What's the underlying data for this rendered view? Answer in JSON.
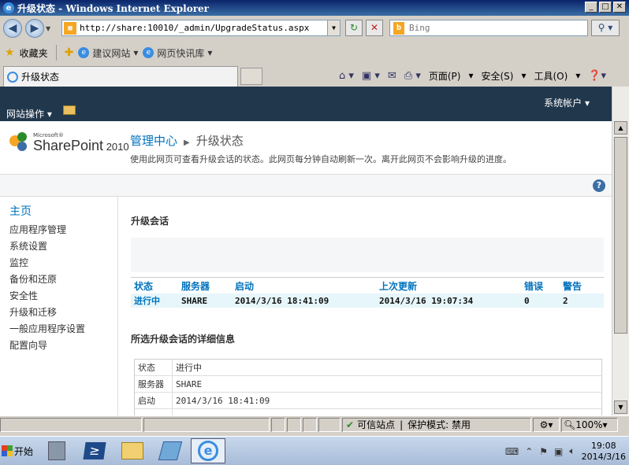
{
  "window": {
    "title": "升级状态 - Windows Internet Explorer"
  },
  "address": {
    "url": "http://share:10010/_admin/UpgradeStatus.aspx",
    "search_placeholder": "Bing"
  },
  "favorites_bar": {
    "favorites_label": "收藏夹",
    "suggested_sites": "建议网站",
    "web_slice_gallery": "网页快讯库"
  },
  "tabs": [
    {
      "label": "升级状态"
    }
  ],
  "command_bar": {
    "page": "页面(P)",
    "safety": "安全(S)",
    "tools": "工具(O)"
  },
  "ribbon": {
    "site_actions": "网站操作",
    "system_account": "系统帐户"
  },
  "brand": {
    "ms": "Microsoft®",
    "name": "SharePoint",
    "year": "2010"
  },
  "breadcrumb": {
    "root": "管理中心",
    "current": "升级状态"
  },
  "page_description": "使用此网页可查看升级会话的状态。此网页每分钟自动刷新一次。离开此网页不会影响升级的进度。",
  "left_nav": {
    "home": "主页",
    "items": [
      "应用程序管理",
      "系统设置",
      "监控",
      "备份和还原",
      "安全性",
      "升级和迁移",
      "一般应用程序设置",
      "配置向导"
    ]
  },
  "upgrade_sessions": {
    "title": "升级会话",
    "headers": [
      "状态",
      "服务器",
      "启动",
      "上次更新",
      "错误",
      "警告"
    ],
    "rows": [
      [
        "进行中",
        "SHARE",
        "2014/3/16  18:41:09",
        "2014/3/16  19:07:34",
        "0",
        "2"
      ]
    ]
  },
  "details": {
    "title": "所选升级会话的详细信息",
    "rows": [
      {
        "key": "状态",
        "value": "进行中"
      },
      {
        "key": "服务器",
        "value": "SHARE"
      },
      {
        "key": "启动",
        "value": "2014/3/16 18:41:09"
      }
    ]
  },
  "status_bar": {
    "trusted": "可信站点",
    "protected_mode": "保护模式: 禁用",
    "zoom": "100%"
  },
  "taskbar": {
    "start": "开始",
    "time": "19:08",
    "date": "2014/3/16"
  }
}
